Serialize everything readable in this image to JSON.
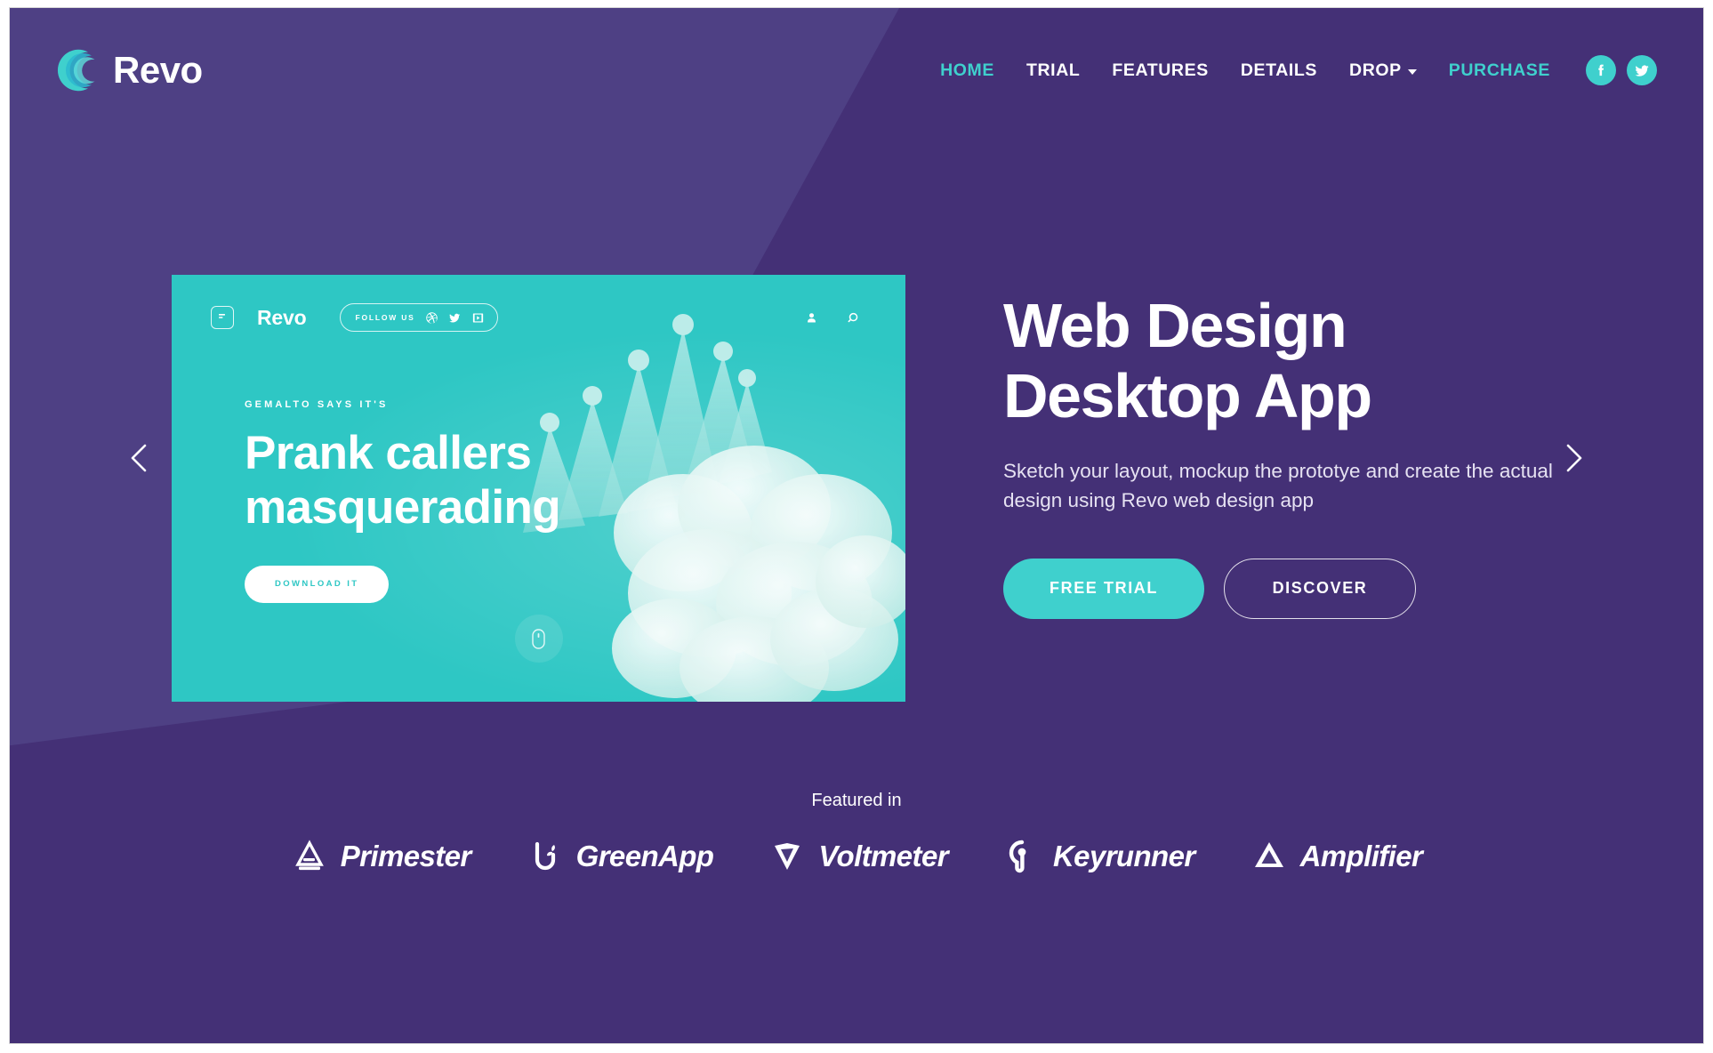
{
  "brand": {
    "name": "Revo",
    "logo_icon": "crescent-arc-icon",
    "accent_color": "#3fd0cd",
    "bg_color": "#443076",
    "bg_light_color": "#4e4084"
  },
  "nav": {
    "items": [
      {
        "label": "HOME",
        "accent": true,
        "dropdown": false
      },
      {
        "label": "TRIAL",
        "accent": false,
        "dropdown": false
      },
      {
        "label": "FEATURES",
        "accent": false,
        "dropdown": false
      },
      {
        "label": "DETAILS",
        "accent": false,
        "dropdown": false
      },
      {
        "label": "DROP",
        "accent": false,
        "dropdown": true
      },
      {
        "label": "PURCHASE",
        "accent": true,
        "dropdown": false
      }
    ],
    "social": [
      {
        "name": "facebook-icon"
      },
      {
        "name": "twitter-icon"
      }
    ]
  },
  "slide": {
    "brand": "Revo",
    "logo_icon": "app-square-icon",
    "follow_label": "FOLLOW US",
    "follow_icons": [
      "dribbble-icon",
      "twitter-icon",
      "video-play-icon"
    ],
    "right_icons": [
      "user-icon",
      "search-icon"
    ],
    "eyebrow": "GEMALTO SAYS IT'S",
    "title": "Prank callers masquerading",
    "cta": "DOWNLOAD IT",
    "scroll_icon": "mouse-scroll-icon",
    "bg_color": "#2ec7c4"
  },
  "carousel": {
    "prev_icon": "chevron-left-icon",
    "next_icon": "chevron-right-icon"
  },
  "hero": {
    "headline_line1": "Web Design",
    "headline_line2": "Desktop App",
    "subhead": "Sketch your layout, mockup the prototye and create the actual design using Revo web design app",
    "primary_cta": "FREE TRIAL",
    "secondary_cta": "DISCOVER"
  },
  "featured": {
    "label": "Featured in",
    "logos": [
      {
        "name": "Primester",
        "icon": "primester-triangle-icon"
      },
      {
        "name": "GreenApp",
        "icon": "greenapp-sprout-icon"
      },
      {
        "name": "Voltmeter",
        "icon": "voltmeter-shield-icon"
      },
      {
        "name": "Keyrunner",
        "icon": "keyrunner-keyhole-icon"
      },
      {
        "name": "Amplifier",
        "icon": "amplifier-delta-icon"
      }
    ]
  }
}
